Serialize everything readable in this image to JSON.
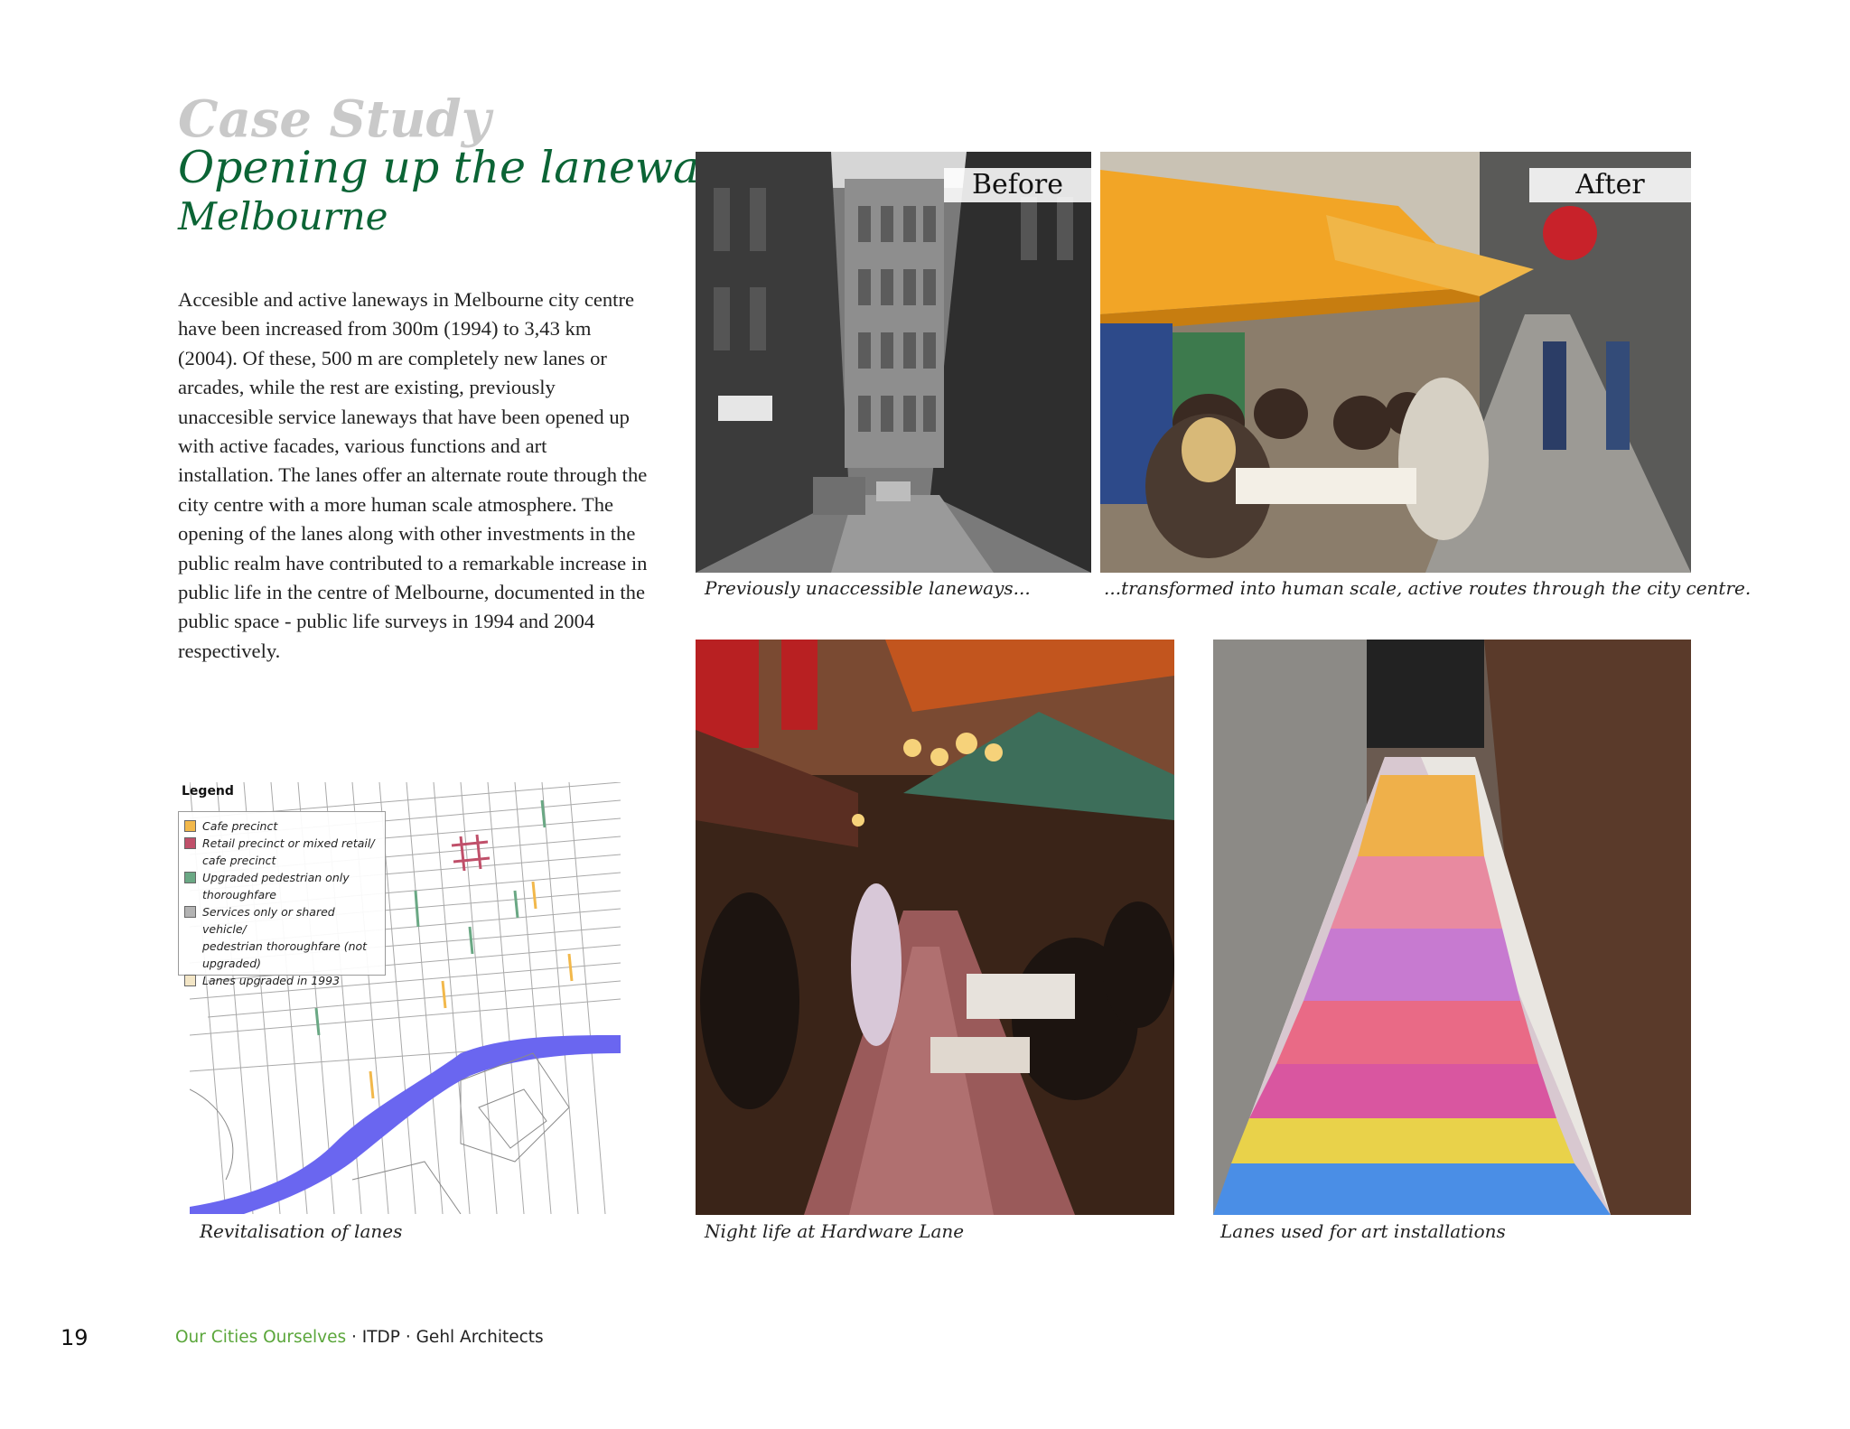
{
  "header": {
    "kicker": "Case Study",
    "title": "Opening up the laneways",
    "subtitle": "Melbourne"
  },
  "body": {
    "paragraph": "Accesible and active laneways in Melbourne city centre have been increased from 300m (1994) to 3,43 km (2004). Of these, 500 m are completely new lanes or arcades, while the rest are existing, previously unaccesible service laneways that have been opened up with active facades, various functions and art installation. The lanes offer an alternate route through the city centre with a more human scale atmosphere. The opening of the lanes along with other investments in the public realm have contributed to a remarkable increase in public life in the centre of Melbourne, documented in the public space - public life surveys in 1994 and 2004 respectively."
  },
  "photos": {
    "before": {
      "tag": "Before",
      "caption": "Previously unaccessible laneways..."
    },
    "after": {
      "tag": "After",
      "caption": "...transformed into human scale, active routes through the city centre."
    },
    "night": {
      "caption": "Night life at Hardware Lane"
    },
    "art": {
      "caption": "Lanes used for art installations"
    }
  },
  "map": {
    "caption": "Revitalisation of lanes",
    "legend_title": "Legend",
    "legend": [
      {
        "label": "Cafe precinct",
        "color": "#f2b84b"
      },
      {
        "label": "Retail precinct or mixed retail/\ncafe precinct",
        "color": "#c0506a"
      },
      {
        "label": "Upgraded pedestrian only\nthoroughfare",
        "color": "#6aa884"
      },
      {
        "label": "Services only or shared vehicle/\npedestrian thoroughfare (not\nupgraded)",
        "color": "#b3b3b3"
      },
      {
        "label": "Lanes upgraded in 1993",
        "color": "#f3e6c6"
      }
    ],
    "river_color": "#6a66f0"
  },
  "footer": {
    "page_number": "19",
    "publication": "Our Cities Ourselves",
    "orgs": " · ITDP · Gehl Architects"
  }
}
